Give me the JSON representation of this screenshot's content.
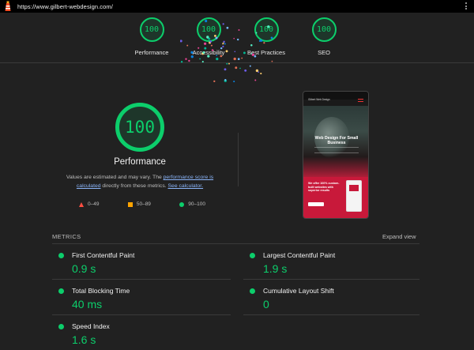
{
  "browser": {
    "url": "https://www.gilbert-webdesign.com/",
    "logo_icon": "lighthouse-icon",
    "menu_icon": "kebab-menu-icon"
  },
  "top_scores": [
    {
      "score": "100",
      "label": "Performance"
    },
    {
      "score": "100",
      "label": "Accessibility"
    },
    {
      "score": "100",
      "label": "Best Practices"
    },
    {
      "score": "100",
      "label": "SEO"
    }
  ],
  "performance": {
    "score": "100",
    "title": "Performance",
    "desc_before": "Values are estimated and may vary. The ",
    "desc_link1": "performance score is calculated",
    "desc_middle": " directly from these metrics. ",
    "desc_link2": "See calculator."
  },
  "legend": [
    {
      "shape": "triangle",
      "range": "0–49",
      "color": "#ff4e42"
    },
    {
      "shape": "square",
      "range": "50–89",
      "color": "#ffa400"
    },
    {
      "shape": "circle",
      "range": "90–100",
      "color": "#0cce6b"
    }
  ],
  "phone_preview": {
    "brand": "Gilbert Web Design",
    "hero_heading": "Web Design For Small Business",
    "red_text": "We offer 100% custom-built websites with superior results"
  },
  "metrics": {
    "heading": "METRICS",
    "expand_label": "Expand view",
    "items": [
      {
        "name": "First Contentful Paint",
        "value": "0.9 s"
      },
      {
        "name": "Largest Contentful Paint",
        "value": "1.9 s"
      },
      {
        "name": "Total Blocking Time",
        "value": "40 ms"
      },
      {
        "name": "Cumulative Layout Shift",
        "value": "0"
      },
      {
        "name": "Speed Index",
        "value": "1.6 s"
      }
    ]
  },
  "colors": {
    "pass": "#0cce6b",
    "average": "#ffa400",
    "fail": "#ff4e42",
    "link": "#8ab4f8",
    "background": "#212121"
  }
}
